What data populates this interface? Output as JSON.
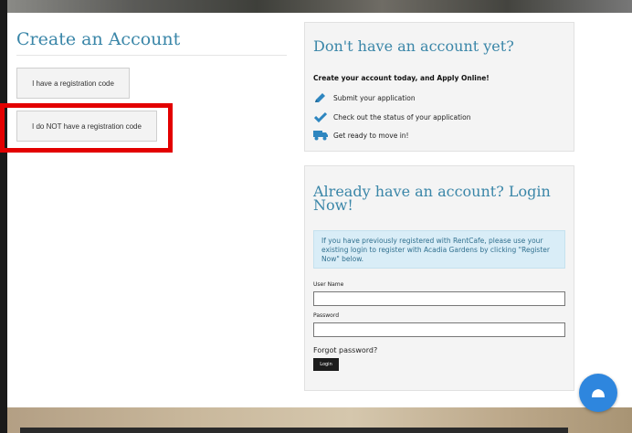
{
  "left": {
    "title": "Create an Account",
    "btn_with_code": "I have a registration code",
    "btn_no_code": "I do NOT have a registration code"
  },
  "promo": {
    "title": "Don't have an account yet?",
    "subtitle": "Create your account today, and Apply Online!",
    "features": [
      {
        "icon": "pencil-icon",
        "text": "Submit your application"
      },
      {
        "icon": "checkmark-icon",
        "text": "Check out the status of your application"
      },
      {
        "icon": "truck-icon",
        "text": "Get ready to move in!"
      }
    ]
  },
  "login": {
    "title": "Already have an account? Login Now!",
    "info": "If you have previously registered with RentCafe, please use your existing login to register with Acadia Gardens by clicking \"Register Now\" below.",
    "username_label": "User Name",
    "password_label": "Password",
    "forgot": "Forgot password?",
    "login_button": "Login"
  },
  "colors": {
    "heading": "#3a86a8",
    "highlight": "#e30000",
    "fab": "#2e86de",
    "icon": "#2e86c0"
  }
}
